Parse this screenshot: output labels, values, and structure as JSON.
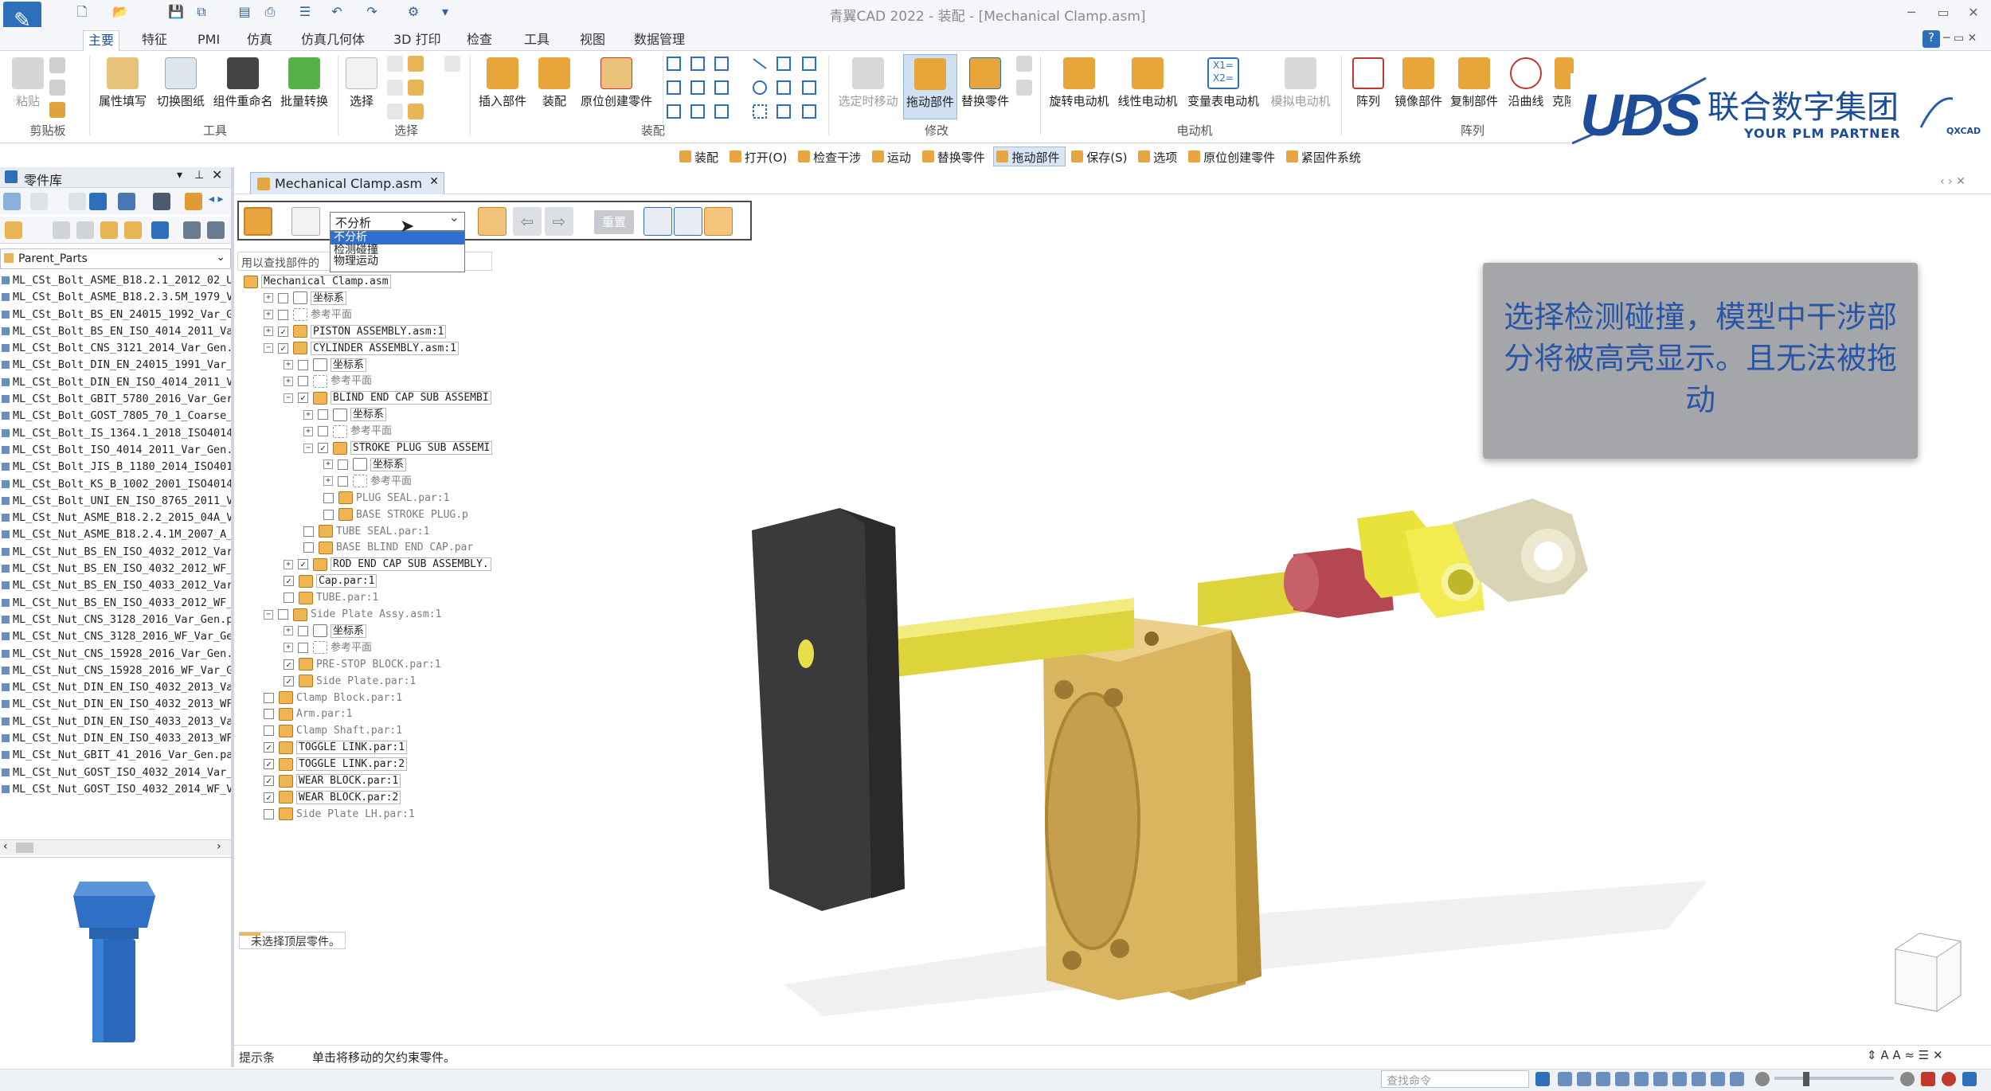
{
  "window": {
    "title": "青翼CAD 2022 - 装配 - [Mechanical Clamp.asm]",
    "controls": [
      "─",
      "▭",
      "✕"
    ]
  },
  "menu_tabs": [
    "主要",
    "特征",
    "PMI",
    "仿真",
    "仿真几何体",
    "3D 打印",
    "检查",
    "工具",
    "视图",
    "数据管理"
  ],
  "ribbon": {
    "clipboard_paste": "粘贴",
    "groups": {
      "clipboard": "剪贴板",
      "tools": "工具",
      "select": "选择",
      "assembly": "装配",
      "modify": "修改",
      "motor": "电动机",
      "pattern": "阵列"
    },
    "tools": [
      "属性填写",
      "切换图纸",
      "组件重命名",
      "批量转换"
    ],
    "select": "选择",
    "assembly": [
      "插入部件",
      "装配",
      "原位创建零件"
    ],
    "modify": [
      "选定时移动",
      "拖动部件",
      "替换零件"
    ],
    "motor": [
      "旋转电动机",
      "线性电动机",
      "变量表电动机",
      "模拟电动机"
    ],
    "pattern": [
      "阵列",
      "镜像部件",
      "复制部件",
      "沿曲线",
      "克隆"
    ]
  },
  "brand": {
    "logo_text": "UDS",
    "name": "联合数字集团",
    "slogan": "YOUR PLM PARTNER",
    "small_logo": "QXCAD"
  },
  "command_strip": [
    "装配",
    "打开(O)",
    "检查干涉",
    "运动",
    "替换零件",
    "拖动部件",
    "保存(S)",
    "选项",
    "原位创建零件",
    "紧固件系统"
  ],
  "left_panel": {
    "title": "零件库",
    "combo_value": "Parent_Parts",
    "parts": [
      "ML_CSt_Bolt_ASME_B18.2.1_2012_02_U",
      "ML_CSt_Bolt_ASME_B18.2.3.5M_1979_V",
      "ML_CSt_Bolt_BS_EN_24015_1992_Var_G",
      "ML_CSt_Bolt_BS_EN_ISO_4014_2011_Va",
      "ML_CSt_Bolt_CNS_3121_2014_Var_Gen.",
      "ML_CSt_Bolt_DIN_EN_24015_1991_Var_",
      "ML_CSt_Bolt_DIN_EN_ISO_4014_2011_V",
      "ML_CSt_Bolt_GBIT_5780_2016_Var_Ger",
      "ML_CSt_Bolt_GOST_7805_70_1_Coarse_",
      "ML_CSt_Bolt_IS_1364.1_2018_ISO4014",
      "ML_CSt_Bolt_ISO_4014_2011_Var_Gen.",
      "ML_CSt_Bolt_JIS_B_1180_2014_ISO401",
      "ML_CSt_Bolt_KS_B_1002_2001_ISO4014",
      "ML_CSt_Bolt_UNI_EN_ISO_8765_2011_V",
      "ML_CSt_Nut_ASME_B18.2.2_2015_04A_V",
      "ML_CSt_Nut_ASME_B18.2.4.1M_2007_A_",
      "ML_CSt_Nut_BS_EN_ISO_4032_2012_Var",
      "ML_CSt_Nut_BS_EN_ISO_4032_2012_WF_",
      "ML_CSt_Nut_BS_EN_ISO_4033_2012_Var",
      "ML_CSt_Nut_BS_EN_ISO_4033_2012_WF_",
      "ML_CSt_Nut_CNS_3128_2016_Var_Gen.p",
      "ML_CSt_Nut_CNS_3128_2016_WF_Var_Ge",
      "ML_CSt_Nut_CNS_15928_2016_Var_Gen.",
      "ML_CSt_Nut_CNS_15928_2016_WF_Var_G",
      "ML_CSt_Nut_DIN_EN_ISO_4032_2013_Va",
      "ML_CSt_Nut_DIN_EN_ISO_4032_2013_WF",
      "ML_CSt_Nut_DIN_EN_ISO_4033_2013_Va",
      "ML_CSt_Nut_DIN_EN_ISO_4033_2013_WF",
      "ML_CSt_Nut_GBIT_41_2016_Var_Gen.pa",
      "ML_CSt_Nut_GOST_ISO_4032_2014_Var_",
      "ML_CSt_Nut_GOST_ISO_4032_2014_WF_V"
    ]
  },
  "document_tab": "Mechanical Clamp.asm",
  "drag_toolbar": {
    "analysis_value": "不分析",
    "analysis_options": [
      "不分析",
      "检测碰撞",
      "物理运动"
    ],
    "reset_label": "重置",
    "search_placeholder": "用以查找部件的"
  },
  "tree": [
    {
      "text": "Mechanical Clamp.asm",
      "indent": 0,
      "exp": "",
      "cb": "",
      "icon": "asm",
      "style": "boxed"
    },
    {
      "text": "坐标系",
      "indent": 1,
      "exp": "+",
      "cb": " ",
      "icon": "coord",
      "style": "boxed"
    },
    {
      "text": "参考平面",
      "indent": 1,
      "exp": "+",
      "cb": " ",
      "icon": "plane",
      "style": "gray"
    },
    {
      "text": "PISTON ASSEMBLY.asm:1",
      "indent": 1,
      "exp": "+",
      "cb": "✓",
      "icon": "asm",
      "style": "boxed"
    },
    {
      "text": "CYLINDER ASSEMBLY.asm:1",
      "indent": 1,
      "exp": "−",
      "cb": "✓",
      "icon": "asm",
      "style": "boxed"
    },
    {
      "text": "坐标系",
      "indent": 2,
      "exp": "+",
      "cb": " ",
      "icon": "coord",
      "style": "boxed"
    },
    {
      "text": "参考平面",
      "indent": 2,
      "exp": "+",
      "cb": " ",
      "icon": "plane",
      "style": "gray"
    },
    {
      "text": "BLIND END CAP SUB ASSEMBI",
      "indent": 2,
      "exp": "−",
      "cb": "✓",
      "icon": "asm",
      "style": "boxed"
    },
    {
      "text": "坐标系",
      "indent": 3,
      "exp": "+",
      "cb": " ",
      "icon": "coord",
      "style": "boxed"
    },
    {
      "text": "参考平面",
      "indent": 3,
      "exp": "+",
      "cb": " ",
      "icon": "plane",
      "style": "gray"
    },
    {
      "text": "STROKE PLUG SUB ASSEMI",
      "indent": 3,
      "exp": "−",
      "cb": "✓",
      "icon": "asm",
      "style": "boxed"
    },
    {
      "text": "坐标系",
      "indent": 4,
      "exp": "+",
      "cb": " ",
      "icon": "coord",
      "style": "boxed"
    },
    {
      "text": "参考平面",
      "indent": 4,
      "exp": "+",
      "cb": " ",
      "icon": "plane",
      "style": "gray"
    },
    {
      "text": "PLUG SEAL.par:1",
      "indent": 4,
      "exp": "",
      "cb": " ",
      "icon": "par",
      "style": "gray"
    },
    {
      "text": "BASE STROKE PLUG.p",
      "indent": 4,
      "exp": "",
      "cb": " ",
      "icon": "par",
      "style": "gray"
    },
    {
      "text": "TUBE SEAL.par:1",
      "indent": 3,
      "exp": "",
      "cb": " ",
      "icon": "par",
      "style": "gray"
    },
    {
      "text": "BASE BLIND END CAP.par",
      "indent": 3,
      "exp": "",
      "cb": " ",
      "icon": "par",
      "style": "gray"
    },
    {
      "text": "ROD END CAP SUB ASSEMBLY.",
      "indent": 2,
      "exp": "+",
      "cb": "✓",
      "icon": "asm",
      "style": "boxed"
    },
    {
      "text": "Cap.par:1",
      "indent": 2,
      "exp": "",
      "cb": "✓",
      "icon": "par",
      "style": "boxed"
    },
    {
      "text": "TUBE.par:1",
      "indent": 2,
      "exp": "",
      "cb": " ",
      "icon": "par",
      "style": "gray"
    },
    {
      "text": "Side Plate Assy.asm:1",
      "indent": 1,
      "exp": "−",
      "cb": " ",
      "icon": "asm",
      "style": "gray"
    },
    {
      "text": "坐标系",
      "indent": 2,
      "exp": "+",
      "cb": " ",
      "icon": "coord",
      "style": "boxed"
    },
    {
      "text": "参考平面",
      "indent": 2,
      "exp": "+",
      "cb": " ",
      "icon": "plane",
      "style": "gray"
    },
    {
      "text": "PRE-STOP BLOCK.par:1",
      "indent": 2,
      "exp": "",
      "cb": "✓",
      "icon": "par",
      "style": "gray"
    },
    {
      "text": "Side Plate.par:1",
      "indent": 2,
      "exp": "",
      "cb": "✓",
      "icon": "par",
      "style": "gray"
    },
    {
      "text": "Clamp Block.par:1",
      "indent": 1,
      "exp": "",
      "cb": " ",
      "icon": "par",
      "style": "gray"
    },
    {
      "text": "Arm.par:1",
      "indent": 1,
      "exp": "",
      "cb": " ",
      "icon": "par",
      "style": "gray"
    },
    {
      "text": "Clamp Shaft.par:1",
      "indent": 1,
      "exp": "",
      "cb": " ",
      "icon": "par",
      "style": "gray"
    },
    {
      "text": "TOGGLE LINK.par:1",
      "indent": 1,
      "exp": "",
      "cb": "✓",
      "icon": "par",
      "style": "boxed"
    },
    {
      "text": "TOGGLE LINK.par:2",
      "indent": 1,
      "exp": "",
      "cb": "✓",
      "icon": "par",
      "style": "boxed"
    },
    {
      "text": "WEAR BLOCK.par:1",
      "indent": 1,
      "exp": "",
      "cb": "✓",
      "icon": "par",
      "style": "boxed"
    },
    {
      "text": "WEAR BLOCK.par:2",
      "indent": 1,
      "exp": "",
      "cb": "✓",
      "icon": "par",
      "style": "boxed"
    },
    {
      "text": "Side Plate LH.par:1",
      "indent": 1,
      "exp": "",
      "cb": " ",
      "icon": "par",
      "style": "gray"
    }
  ],
  "tree_note": "未选择顶层零件。",
  "callout_text": "选择检测碰撞，模型中干涉部分将被高亮显示。且无法被拖动",
  "status": {
    "hint_label": "提示条",
    "hint_text": "单击将移动的欠约束零件。",
    "command_search_placeholder": "查找命令"
  },
  "colors": {
    "accent": "#2d6fb8",
    "callout_bg": "#a4a6a9",
    "callout_text": "#2955a8",
    "part_gold": "#e3c06a",
    "rod_yellow": "#e6e04a",
    "seal_red": "#b8464e",
    "handle_dark": "#3a3a3c"
  }
}
